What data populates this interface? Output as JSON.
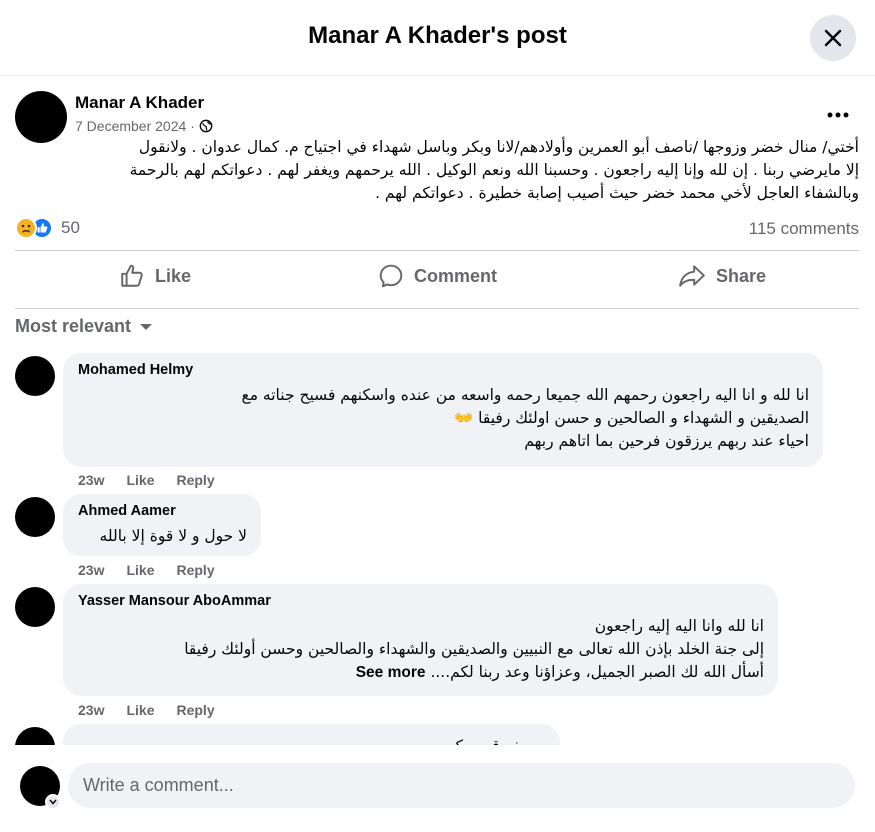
{
  "header": {
    "title": "Manar A Khader's post"
  },
  "post": {
    "author": "Manar A Khader",
    "date": "7 December 2024",
    "separator": "·",
    "text_lines": [
      "أختي/ منال خضر وزوجها /ناصف أبو العمرين وأولادهم/لانا وبكر وباسل شهداء في اجتياح م. كمال عدوان . ولانقول",
      "إلا مايرضي ربنا . إن لله وإنا إليه راجعون . وحسبنا الله ونعم الوكيل . الله يرحمهم ويغفر لهم . دعواتكم لهم بالرحمة",
      "وبالشفاء العاجل لأخي محمد خضر حيث أصيب إصابة خطيرة .  دعواتكم لهم ."
    ],
    "reaction_icons": [
      "sad-reaction",
      "like-reaction"
    ],
    "reaction_count": "50",
    "comments_count": "115 comments"
  },
  "actions": {
    "like": "Like",
    "comment": "Comment",
    "share": "Share"
  },
  "sort": {
    "label": "Most relevant"
  },
  "comments": [
    {
      "name": "Mohamed Helmy",
      "lines": [
        "انا لله و انا اليه راجعون رحمهم الله جميعا رحمه واسعه من عنده واسكنهم فسيح جناته مع",
        "الصديقين و الشهداء و الصالحين و حسن اولئك رفيقا 👐",
        "احياء عند ربهم يرزقون فرحين بما اتاهم ربهم"
      ],
      "time": "23w",
      "like": "Like",
      "reply": "Reply"
    },
    {
      "name": "Ahmed Aamer",
      "lines": [
        "لا حول و لا قوة إلا بالله"
      ],
      "time": "23w",
      "like": "Like",
      "reply": "Reply"
    },
    {
      "name": "Yasser Mansour AboAmmar",
      "lines": [
        "انا لله وانا اليه إليه راجعون",
        "إلى جنة الخلد بإذن الله تعالى مع النبيين والصديقين والشهداء والصالحين وحسن أولئك رفيقا",
        "أسأل الله لك الصبر الجميل، وعزاؤنا وعد ربنا لكم...."
      ],
      "see_more": "See more",
      "time": "23w",
      "like": "Like",
      "reply": "Reply"
    },
    {
      "lines": [
        "يوسف قومو كريم"
      ]
    }
  ],
  "composer": {
    "placeholder": "Write a comment..."
  }
}
